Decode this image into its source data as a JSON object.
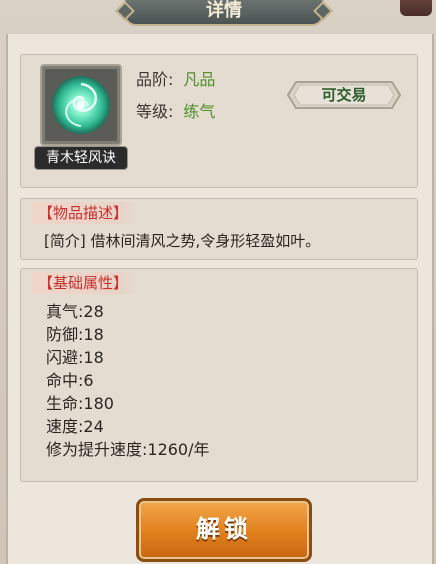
{
  "title": "详情",
  "item": {
    "name": "青木轻风诀",
    "icon": "green-wind-orb-icon",
    "grade_label": "品阶:",
    "grade_value": "凡品",
    "level_label": "等级:",
    "level_value": "练气",
    "trade_label": "可交易"
  },
  "description": {
    "header": "【物品描述】",
    "text": "[简介] 借林间清风之势,令身形轻盈如叶。"
  },
  "attributes": {
    "header": "【基础属性】",
    "rows": [
      "真气:28",
      "防御:18",
      "闪避:18",
      "命中:6",
      "生命:180",
      "速度:24",
      "修为提升速度:1260/年"
    ]
  },
  "unlock_label": "解锁",
  "colors": {
    "accent_red": "#c8302d",
    "value_green": "#4f8f2c",
    "button_orange": "#e0801c"
  }
}
